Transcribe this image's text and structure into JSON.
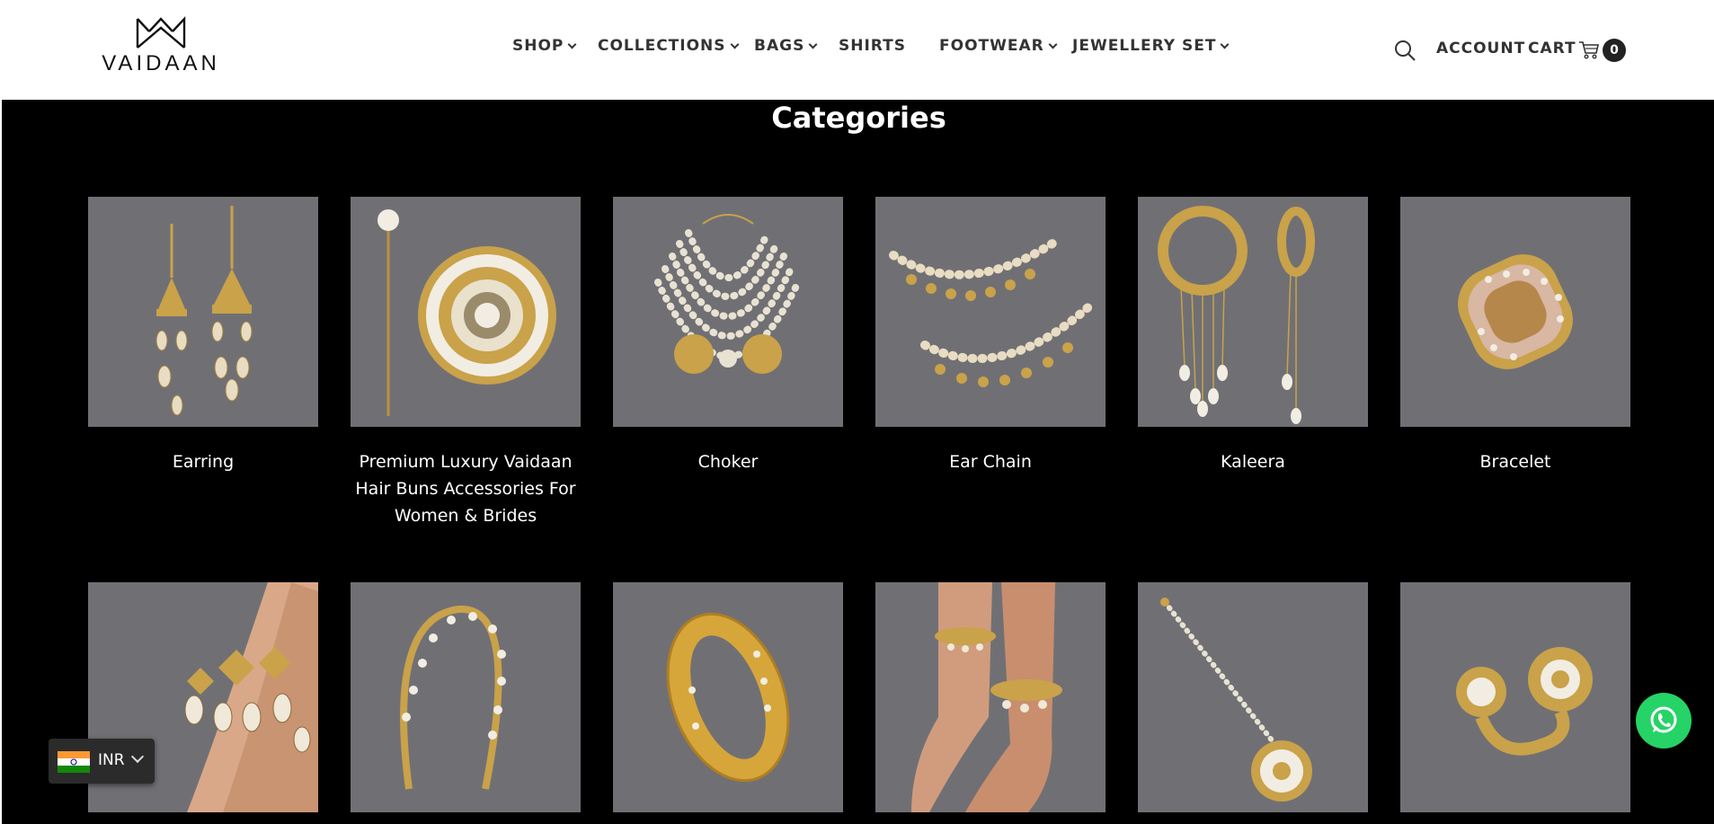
{
  "brand": {
    "name": "VAIDAAN"
  },
  "nav": {
    "items": [
      {
        "label": "SHOP",
        "has_dropdown": true
      },
      {
        "label": "COLLECTIONS",
        "has_dropdown": true
      },
      {
        "label": "BAGS",
        "has_dropdown": true
      },
      {
        "label": "SHIRTS",
        "has_dropdown": false
      },
      {
        "label": "FOOTWEAR",
        "has_dropdown": true
      },
      {
        "label": "JEWELLERY SET",
        "has_dropdown": true
      }
    ]
  },
  "header": {
    "search_icon": "search-icon",
    "account_label": "ACCOUNT",
    "cart_label": "CART",
    "cart_icon": "cart-icon",
    "cart_count": "0"
  },
  "section": {
    "title": "Categories"
  },
  "categories": [
    {
      "label": "Earring"
    },
    {
      "label": "Premium Luxury Vaidaan Hair Buns Accessories For Women & Brides"
    },
    {
      "label": "Choker"
    },
    {
      "label": "Ear Chain"
    },
    {
      "label": "Kaleera"
    },
    {
      "label": "Bracelet"
    },
    {
      "label": ""
    },
    {
      "label": ""
    },
    {
      "label": ""
    },
    {
      "label": ""
    },
    {
      "label": ""
    },
    {
      "label": ""
    }
  ],
  "currency": {
    "code": "INR",
    "flag_icon": "india-flag-icon"
  },
  "whatsapp": {
    "icon": "whatsapp-icon"
  },
  "colors": {
    "page_bg": "#000000",
    "header_bg": "#ffffff",
    "tile_bg": "#707074",
    "gold": "#c9a24a",
    "pearl": "#f2ede2",
    "whatsapp": "#25d366"
  }
}
